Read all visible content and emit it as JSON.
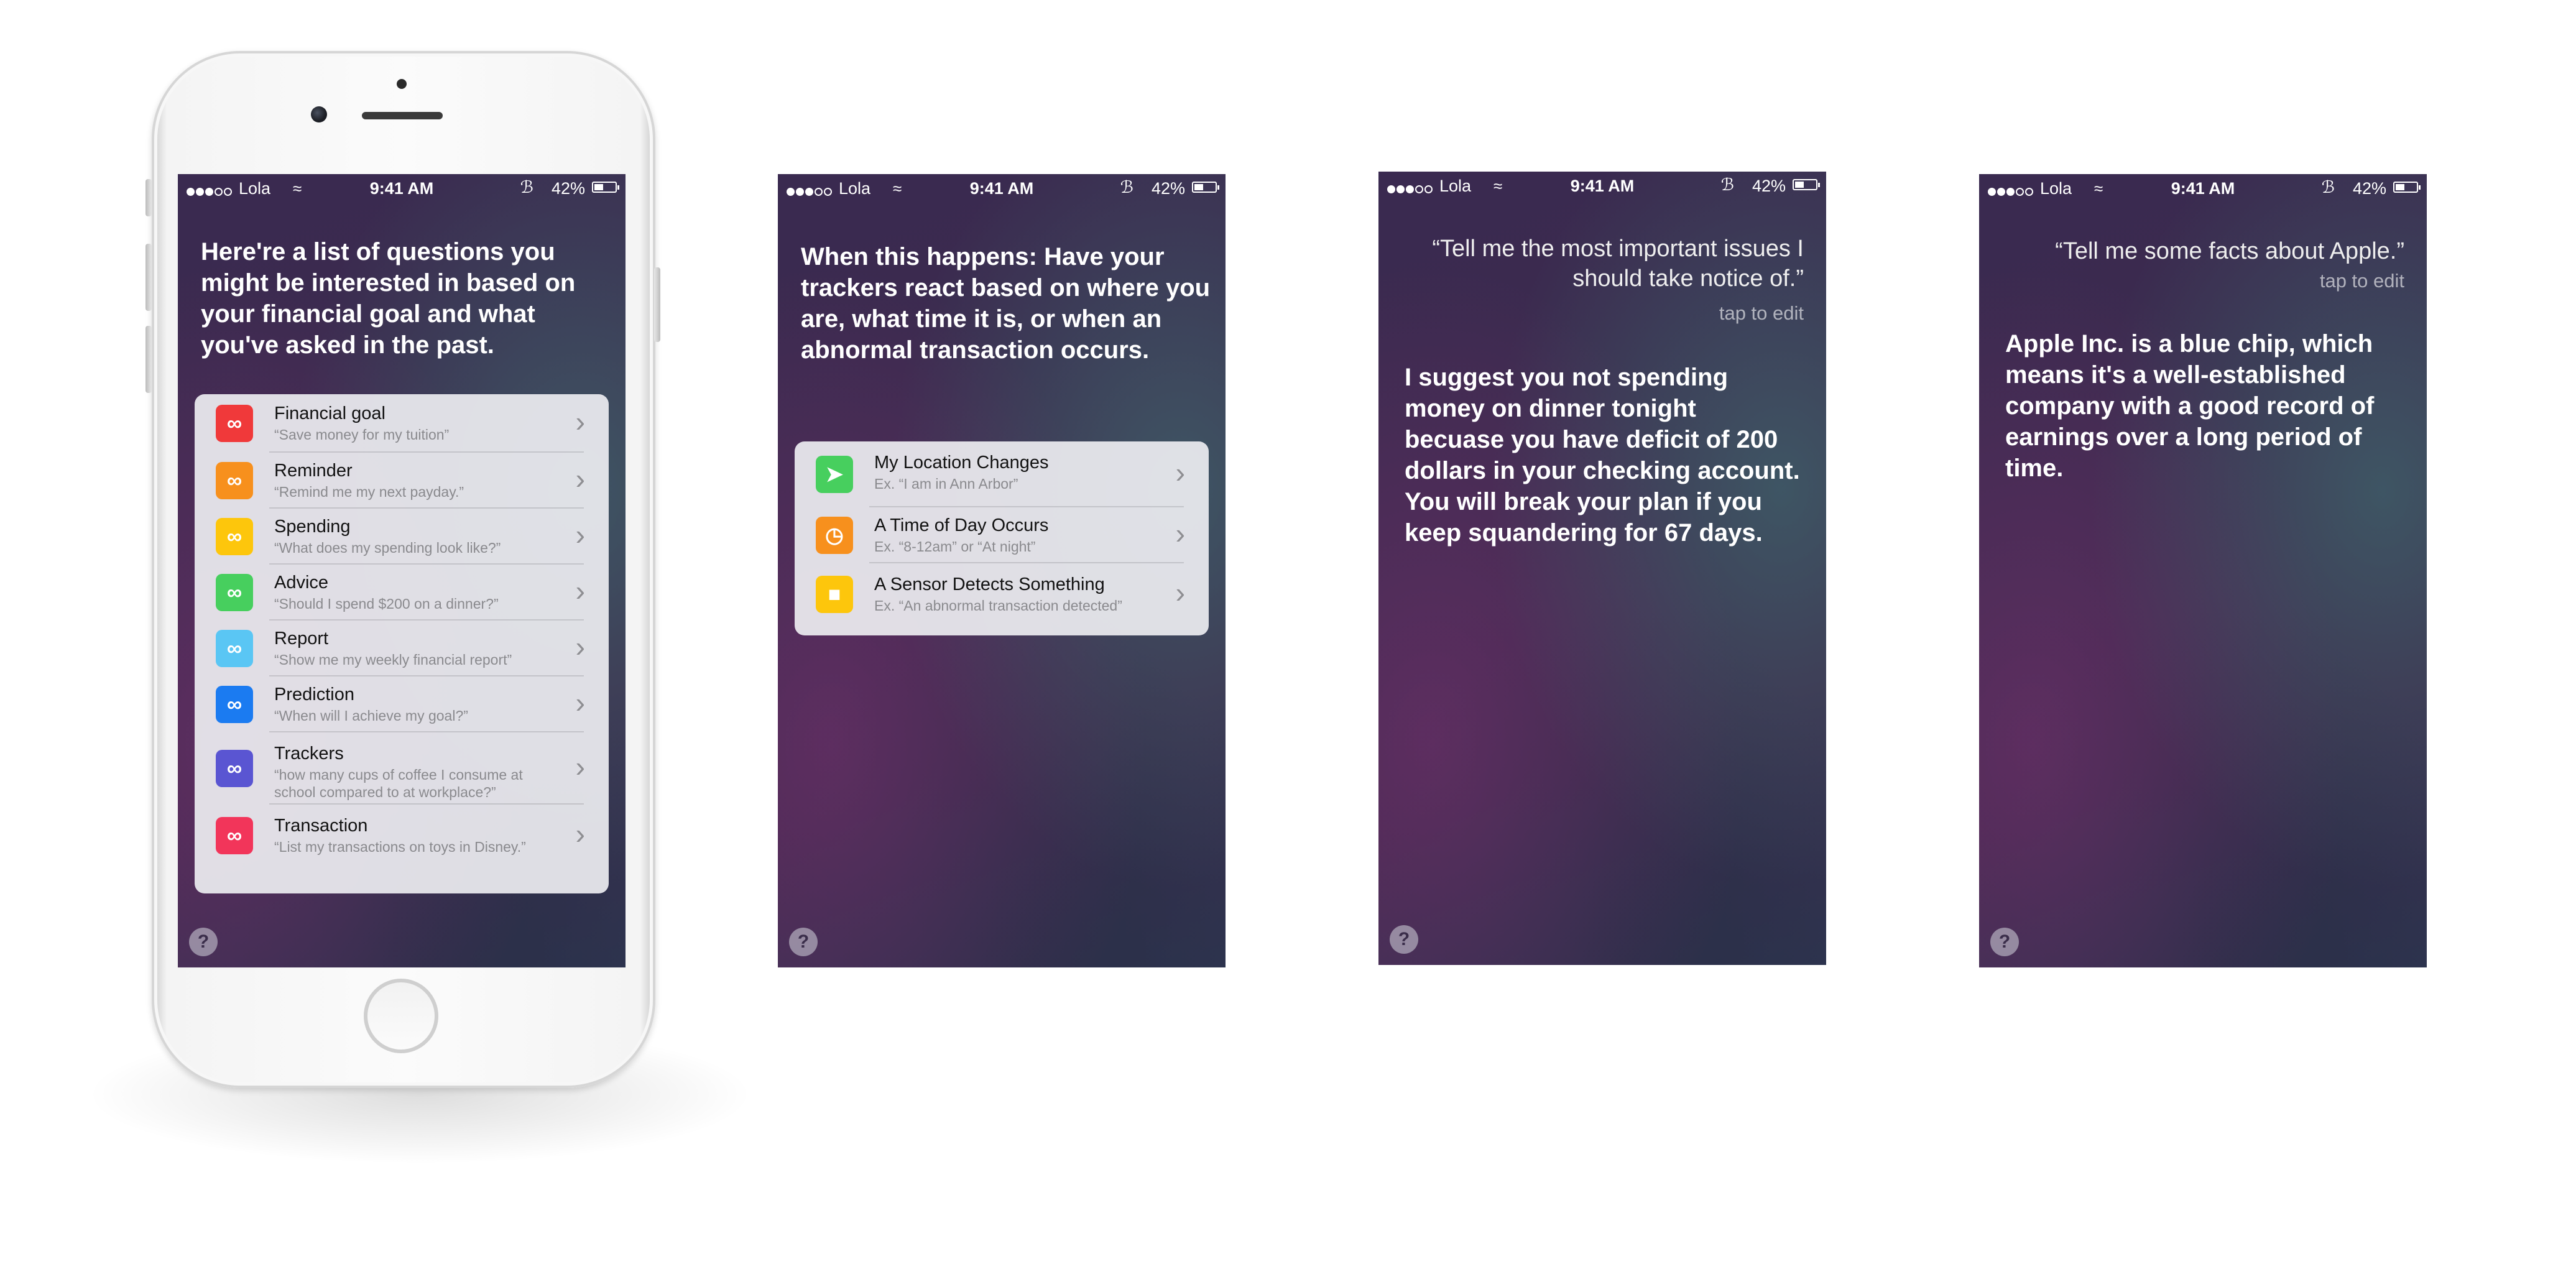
{
  "status_bar": {
    "carrier": "Lola",
    "time": "9:41 AM",
    "battery": "42%",
    "wifi_icon": "wifi-icon",
    "bluetooth_icon": "bluetooth-icon"
  },
  "screen1": {
    "headline": "Here're a list of questions you might be interested in based on your financial goal and what you've asked in the past.",
    "items": [
      {
        "title": "Financial goal",
        "subtitle": "“Save money for my tuition”",
        "color": "#f0393a",
        "icon": "link-icon"
      },
      {
        "title": "Reminder",
        "subtitle": "“Remind me my next payday.”",
        "color": "#f7901d",
        "icon": "link-icon"
      },
      {
        "title": "Spending",
        "subtitle": "“What does my spending look like?”",
        "color": "#fdc60c",
        "icon": "link-icon"
      },
      {
        "title": "Advice",
        "subtitle": "“Should I spend $200 on a dinner?”",
        "color": "#47cf5e",
        "icon": "link-icon"
      },
      {
        "title": "Report",
        "subtitle": "“Show me my weekly financial report”",
        "color": "#5ac6f4",
        "icon": "link-icon"
      },
      {
        "title": "Prediction",
        "subtitle": "“When will I achieve my goal?”",
        "color": "#1b7bf1",
        "icon": "link-icon"
      },
      {
        "title": "Trackers",
        "subtitle": "“how many cups of coffee I consume at school compared to at workplace?”",
        "color": "#5a55d2",
        "icon": "link-icon"
      },
      {
        "title": "Transaction",
        "subtitle": "“List my transactions on toys in Disney.”",
        "color": "#f2355a",
        "icon": "link-icon"
      }
    ],
    "help": "?"
  },
  "screen2": {
    "headline": "When this happens: Have your trackers react based on where you are, what time it is, or when an abnormal transaction occurs.",
    "items": [
      {
        "title": "My Location Changes",
        "subtitle": "Ex. “I am in Ann Arbor”",
        "color": "#47cf5e",
        "icon": "location-arrow-icon"
      },
      {
        "title": "A Time of Day Occurs",
        "subtitle": "Ex. “8-12am” or “At night”",
        "color": "#f7901d",
        "icon": "clock-icon"
      },
      {
        "title": "A Sensor Detects Something",
        "subtitle": "Ex. “An abnormal transaction detected”",
        "color": "#fdc60c",
        "icon": "sensor-icon"
      }
    ],
    "help": "?"
  },
  "screen3": {
    "quote": "“Tell me the most important issues I should take notice of.”",
    "tap_to_edit": "tap to edit",
    "answer": "I suggest you not spending money on dinner tonight becuase you have deficit of 200 dollars in your checking account. You will break your plan if you keep squandering for 67 days.",
    "help": "?"
  },
  "screen4": {
    "quote": "“Tell me some facts about Apple.”",
    "tap_to_edit": "tap to edit",
    "answer": "Apple Inc. is a blue chip, which means it's a well-established company with a good record of earnings over a long period of time.",
    "help": "?"
  }
}
